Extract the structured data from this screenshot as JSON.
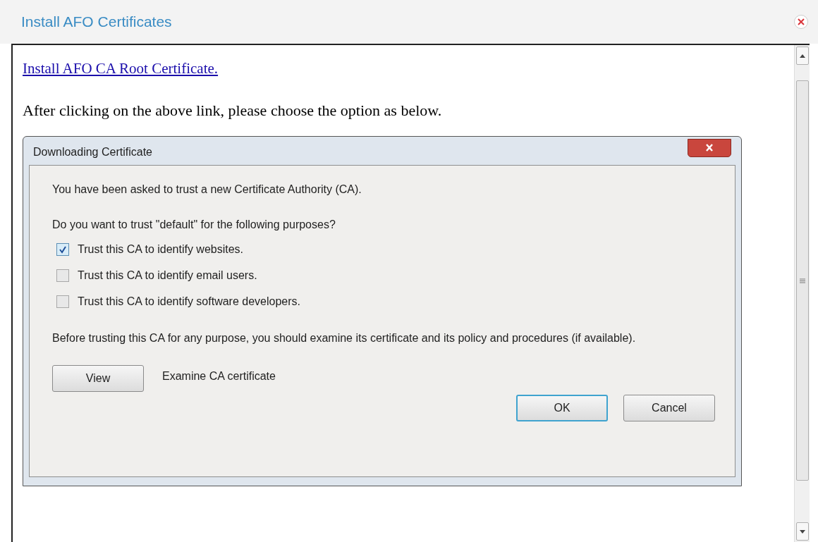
{
  "window": {
    "title": "Install AFO Certificates"
  },
  "content": {
    "link": "Install AFO CA Root Certificate.",
    "instruction": "After clicking on the above link, please choose the option as below."
  },
  "dialog": {
    "title": "Downloading Certificate",
    "intro": "You have been asked to trust a new Certificate Authority (CA).",
    "question": "Do you want to trust \"default\" for the following purposes?",
    "options": [
      {
        "label": "Trust this CA to identify websites.",
        "checked": true
      },
      {
        "label": "Trust this CA to identify email users.",
        "checked": false
      },
      {
        "label": "Trust this CA to identify software developers.",
        "checked": false
      }
    ],
    "advice": "Before trusting this CA for any purpose, you should examine its certificate and its policy and procedures (if available).",
    "view_button": "View",
    "view_caption": "Examine CA certificate",
    "buttons": [
      {
        "label": "OK",
        "selected": true
      },
      {
        "label": "Cancel",
        "selected": false
      }
    ]
  }
}
